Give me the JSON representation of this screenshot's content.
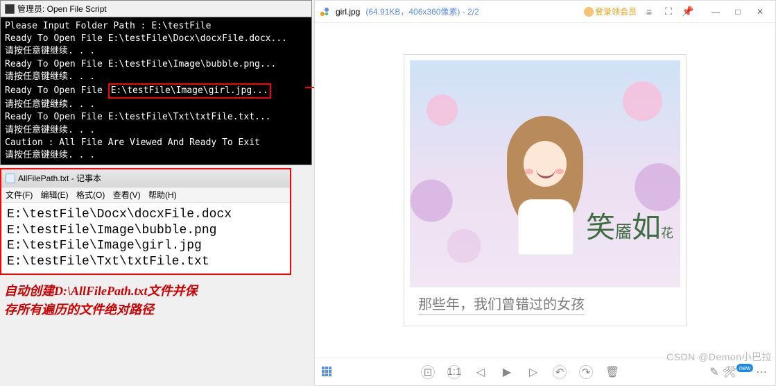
{
  "console": {
    "title": "管理员: Open File Script",
    "lines": [
      "Please Input Folder Path : E:\\testFile",
      "Ready To Open File E:\\testFile\\Docx\\docxFile.docx...",
      "请按任意键继续. . .",
      "Ready To Open File E:\\testFile\\Image\\bubble.png...",
      "请按任意键继续. . ."
    ],
    "highlight_prefix": "Ready To Open File ",
    "highlight_path": "E:\\testFile\\Image\\girl.jpg...",
    "lines_after": [
      "请按任意键继续. . .",
      "Ready To Open File E:\\testFile\\Txt\\txtFile.txt...",
      "请按任意键继续. . .",
      "Caution : All File Are Viewed And Ready To Exit",
      "请按任意键继续. . ."
    ]
  },
  "notepad": {
    "title": "AllFilePath.txt - 记事本",
    "menu": {
      "file": "文件(F)",
      "edit": "编辑(E)",
      "format": "格式(O)",
      "view": "查看(V)",
      "help": "帮助(H)"
    },
    "body_lines": [
      "E:\\testFile\\Docx\\docxFile.docx",
      "E:\\testFile\\Image\\bubble.png",
      "E:\\testFile\\Image\\girl.jpg",
      "E:\\testFile\\Txt\\txtFile.txt"
    ]
  },
  "annotation": {
    "line1": "自动创建D:\\AllFilePath.txt文件并保",
    "line2": "存所有遍历的文件绝对路径"
  },
  "viewer": {
    "filename": "girl.jpg",
    "meta": "(64.91KB，406x360像素) - 2/2",
    "login_label": "登录领会员",
    "image_title_calligraphy": {
      "c1": "笑",
      "c2": "靥",
      "c3": "如",
      "c4": "花"
    },
    "caption": "那些年，我们曾错过的女孩"
  },
  "watermark": "CSDN @Demon小巴拉"
}
